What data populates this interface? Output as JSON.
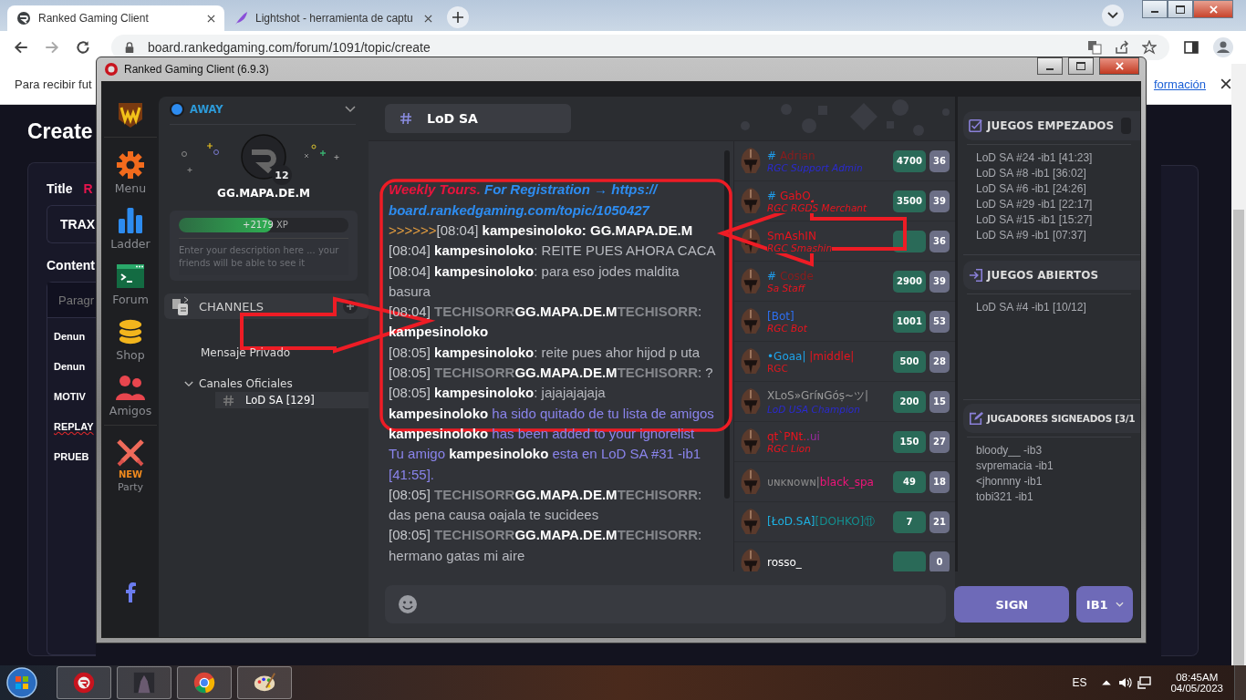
{
  "browser": {
    "tabs": [
      {
        "title": "Ranked Gaming Client",
        "selected": true
      },
      {
        "title": "Lightshot - herramienta de captu",
        "selected": false
      }
    ],
    "url": "board.rankedgaming.com/forum/1091/topic/create"
  },
  "page": {
    "notice": "Para recibir fut",
    "notice_link": "formación",
    "heading": "Create",
    "title_label": "Title",
    "title_mark": "R",
    "title_value": "TRAX",
    "content_label": "Content",
    "editor_placeholder": "Paragr",
    "lines": [
      {
        "text": "Denun",
        "misspelled": false
      },
      {
        "text": "Denun",
        "misspelled": false
      },
      {
        "text": "MOTIV",
        "misspelled": false
      },
      {
        "text": "REPLAY",
        "misspelled": true
      },
      {
        "text": "PRUEB",
        "misspelled": false
      }
    ]
  },
  "client": {
    "title": "Ranked Gaming Client (6.9.3)",
    "nav": [
      {
        "kind": "game"
      },
      {
        "kind": "menu",
        "label": "Menu"
      },
      {
        "kind": "ladder",
        "label": "Ladder"
      },
      {
        "kind": "forum",
        "label": "Forum"
      },
      {
        "kind": "shop",
        "label": "Shop"
      },
      {
        "kind": "friends",
        "label": "Amigos"
      },
      {
        "kind": "party",
        "label": "Party",
        "badge": "NEW"
      },
      {
        "kind": "facebook"
      }
    ],
    "profile": {
      "status": "AWAY",
      "rank_badge": "12",
      "name": "GG.MAPA.DE.M",
      "xp": {
        "level": 0.55,
        "label": "+2179",
        "unit": "XP"
      },
      "description_placeholder": "Enter your description here ... your friends will be able to see it"
    },
    "channels": {
      "title": "CHANNELS",
      "items": [
        {
          "kind": "item",
          "label": "Mensaje Privado",
          "selected": false
        },
        {
          "kind": "group",
          "label": "Canales Oficiales",
          "selected": false,
          "expanded": true,
          "children": [
            {
              "label": "LoD SA [129]",
              "selected": true
            }
          ]
        }
      ]
    },
    "chat": {
      "channel": "LoD SA",
      "messages": [
        [
          {
            "kind": "promo-red",
            "text": "Weekly Tours."
          },
          {
            "kind": "promo-blue",
            "text": " For Registration → https:// board.rankedgaming.com/topic/1050427"
          }
        ],
        [
          {
            "kind": "prefix",
            "text": ">>>>>>"
          },
          {
            "kind": "time",
            "text": "[08:04]"
          },
          {
            "kind": "nick",
            "text": " kampesinoloko: GG.MAPA.DE.M"
          }
        ],
        [
          {
            "kind": "time",
            "text": "[08:04]"
          },
          {
            "kind": "nick",
            "text": " kampesinoloko"
          },
          {
            "kind": "text",
            "text": ": REITE PUES AHORA CACA"
          }
        ],
        [
          {
            "kind": "time",
            "text": "[08:04]"
          },
          {
            "kind": "nick",
            "text": " kampesinoloko"
          },
          {
            "kind": "text",
            "text": ": para eso jodes maldita basura"
          }
        ],
        [
          {
            "kind": "time",
            "text": "[08:04]"
          },
          {
            "kind": "dim",
            "text": " TECHISORR"
          },
          {
            "kind": "nick",
            "text": "GG.MAPA.DE.M"
          },
          {
            "kind": "dim",
            "text": "TECHISORR"
          },
          {
            "kind": "text",
            "text": ": "
          },
          {
            "kind": "nick",
            "text": "kampesinoloko"
          }
        ],
        [
          {
            "kind": "time",
            "text": "[08:05]"
          },
          {
            "kind": "nick",
            "text": " kampesinoloko"
          },
          {
            "kind": "text",
            "text": ": reite pues ahor hijod p uta"
          }
        ],
        [
          {
            "kind": "time",
            "text": "[08:05]"
          },
          {
            "kind": "dim",
            "text": " TECHISORR"
          },
          {
            "kind": "nick",
            "text": "GG.MAPA.DE.M"
          },
          {
            "kind": "dim",
            "text": "TECHISORR"
          },
          {
            "kind": "text",
            "text": ": ?"
          }
        ],
        [
          {
            "kind": "time",
            "text": "[08:05]"
          },
          {
            "kind": "nick",
            "text": " kampesinoloko"
          },
          {
            "kind": "text",
            "text": ": jajajajajaja"
          }
        ],
        [
          {
            "kind": "nick",
            "text": "kampesinoloko"
          },
          {
            "kind": "notice",
            "text": " ha sido quitado de tu lista de amigos"
          }
        ],
        [
          {
            "kind": "nick",
            "text": "kampesinoloko"
          },
          {
            "kind": "notice",
            "text": " has been added to your ignorelist"
          }
        ],
        [
          {
            "kind": "notice",
            "text": "Tu amigo "
          },
          {
            "kind": "nick",
            "text": "kampesinoloko"
          },
          {
            "kind": "notice",
            "text": " esta en LoD SA #31 -ib1 [41:55]."
          }
        ],
        [
          {
            "kind": "time",
            "text": "[08:05]"
          },
          {
            "kind": "dim",
            "text": " TECHISORR"
          },
          {
            "kind": "nick",
            "text": "GG.MAPA.DE.M"
          },
          {
            "kind": "dim",
            "text": "TECHISORR"
          },
          {
            "kind": "text",
            "text": ": das pena causa oajala te sucidees"
          }
        ],
        [
          {
            "kind": "time",
            "text": "[08:05]"
          },
          {
            "kind": "dim",
            "text": " TECHISORR"
          },
          {
            "kind": "nick",
            "text": "GG.MAPA.DE.M"
          },
          {
            "kind": "dim",
            "text": "TECHISORR"
          },
          {
            "kind": "text",
            "text": ": hermano gatas mi aire"
          }
        ]
      ]
    },
    "users": [
      {
        "name_parts": [
          {
            "text": "#",
            "color": "#1e9be9"
          },
          {
            "text": " Adrian",
            "color": "#8b1c1c"
          }
        ],
        "title": {
          "text": "RGC Support Admin",
          "color": "#2a2ad0"
        },
        "rating": "4700",
        "rank": "36"
      },
      {
        "name_parts": [
          {
            "text": "#",
            "color": "#1e9be9"
          },
          {
            "text": " GabO",
            "color": "#e8141e"
          }
        ],
        "title": {
          "text": "RGC RGDS Merchant",
          "color": "#e8141e"
        },
        "rating": "3500",
        "rank": "39"
      },
      {
        "name_parts": [
          {
            "text": "SmAshIN",
            "color": "#e8141e"
          }
        ],
        "title": {
          "text": "RGC Smashin",
          "color": "#e8141e"
        },
        "rank": "36"
      },
      {
        "name_parts": [
          {
            "text": "#",
            "color": "#1e9be9"
          },
          {
            "text": " Cosde",
            "color": "#8b1c1c"
          }
        ],
        "title": {
          "text": "Sa Staff",
          "color": "#e8141e"
        },
        "rating": "2900",
        "rank": "39"
      },
      {
        "name_parts": [
          {
            "text": "[Bot]",
            "color": "#2d6ff0"
          }
        ],
        "title": {
          "text": "RGC Bot",
          "color": "#e8141e"
        },
        "rating": "1001",
        "rank": "53"
      },
      {
        "name_parts": [
          {
            "text": "•Goaa|",
            "color": "#1ea3e8"
          },
          {
            "text": " |middle|",
            "color": "#e8141e"
          }
        ],
        "title": {
          "text": "RGC",
          "color": "#d8181e",
          "plain": true
        },
        "rating": "500",
        "rank": "28"
      },
      {
        "name_parts": [
          {
            "text": "ⅩLoS»GríɴGóṣ~ツ|",
            "color": "#9a9a9a"
          }
        ],
        "title": {
          "text": "LoD USA Champion",
          "color": "#2a2ad0"
        },
        "rating": "200",
        "rank": "15"
      },
      {
        "name_parts": [
          {
            "text": "qt`PNt.",
            "color": "#e8141e"
          },
          {
            "text": ".ui",
            "color": "#9a2aa0"
          }
        ],
        "title": {
          "text": "RGC Lion",
          "color": "#e8141e"
        },
        "rating": "150",
        "rank": "27"
      },
      {
        "name_parts": [
          {
            "text": "ᴜɴᴋɴᴏᴡɴ|",
            "color": "#8a8a8a"
          },
          {
            "text": "black_spa",
            "color": "#f0147a"
          }
        ],
        "rating": "49",
        "rank": "18"
      },
      {
        "name_parts": [
          {
            "text": "[ŁoD.SA]",
            "color": "#1eb0e0"
          },
          {
            "text": "[DOHKO]⑪",
            "color": "#138f8f"
          }
        ],
        "rating": "7",
        "rank": "21"
      },
      {
        "name_parts": [
          {
            "text": "rosso_",
            "color": "#ffffff"
          }
        ],
        "rank": "0"
      }
    ],
    "games": [
      {
        "kind": "started",
        "title": "JUEGOS EMPEZADOS",
        "items": [
          "LoD SA #24 -ib1 [41:23]",
          "LoD SA #8 -ib1 [36:02]",
          "LoD SA #6 -ib1 [24:26]",
          "LoD SA #29 -ib1 [22:17]",
          "LoD SA #15 -ib1 [15:27]",
          "LoD SA #9 -ib1 [07:37]"
        ]
      },
      {
        "kind": "open",
        "title": "JUEGOS ABIERTOS",
        "items": [
          "LoD SA #4 -ib1 [10/12]"
        ]
      },
      {
        "kind": "signed",
        "title": "JUGADORES SIGNEADOS [3/1",
        "items": [
          "bloody__ -ib3",
          "svpremacia -ib1",
          "<jhonnny -ib1",
          "tobi321 -ib1"
        ]
      }
    ],
    "input": {
      "button": "SIGN",
      "mode": "IB1"
    }
  },
  "taskbar": {
    "apps": [
      {
        "kind": "rgc"
      },
      {
        "kind": "game"
      },
      {
        "kind": "chrome"
      },
      {
        "kind": "paint"
      }
    ],
    "language": "ES",
    "time": "08:45AM",
    "date": "04/05/2023"
  }
}
